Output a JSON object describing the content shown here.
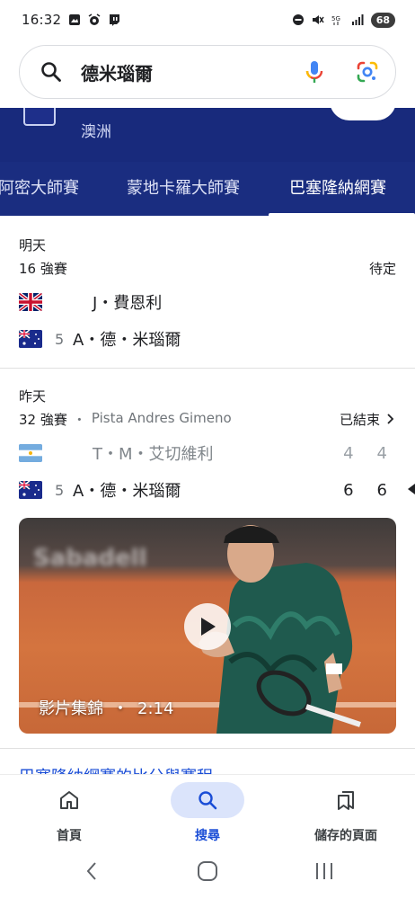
{
  "status_bar": {
    "time": "16:32",
    "battery": "68",
    "left_icons": [
      "gallery-icon",
      "alarm-icon",
      "twitch-icon"
    ],
    "right_icons": [
      "dnd-icon",
      "mute-icon",
      "5g-signal-icon",
      "signal-bars-icon",
      "battery-icon"
    ]
  },
  "search": {
    "query": "德米瑙爾",
    "icons": [
      "search-icon",
      "mic-icon",
      "google-lens-icon"
    ]
  },
  "header": {
    "region": "澳洲",
    "tabs": [
      {
        "label": "阿密大師賽",
        "active": false
      },
      {
        "label": "蒙地卡羅大師賽",
        "active": false
      },
      {
        "label": "巴塞隆納網賽",
        "active": true
      }
    ]
  },
  "matches": [
    {
      "day": "明天",
      "round": "16 強賽",
      "court": "",
      "status": "待定",
      "players": [
        {
          "flag": "uk-flag-icon",
          "seed": "",
          "name": "J・費恩利",
          "scores": []
        },
        {
          "flag": "australia-flag-icon",
          "seed": "5",
          "name": "A・德・米瑙爾",
          "scores": []
        }
      ]
    },
    {
      "day": "昨天",
      "round": "32 強賽",
      "court": "Pista Andres Gimeno",
      "status": "已結束",
      "players": [
        {
          "flag": "argentina-flag-icon",
          "seed": "",
          "name": "T・M・艾切維利",
          "scores": [
            "4",
            "4"
          ]
        },
        {
          "flag": "australia-flag-icon",
          "seed": "5",
          "name": "A・德・米瑙爾",
          "scores": [
            "6",
            "6"
          ]
        }
      ]
    }
  ],
  "video": {
    "label": "影片集錦",
    "separator": "・",
    "duration": "2:14",
    "sponsor": "Sabadell"
  },
  "partial_link": "巴塞隆納網賽的比分與賽程",
  "bottom_nav": [
    {
      "label": "首頁",
      "icon": "home-icon",
      "active": false
    },
    {
      "label": "搜尋",
      "icon": "search-icon",
      "active": true
    },
    {
      "label": "儲存的頁面",
      "icon": "saved-pages-icon",
      "active": false
    }
  ],
  "colors": {
    "header_bg": "#182a7c",
    "accent": "#1a4dd6",
    "active_nav_bg": "#dbe4fb"
  }
}
